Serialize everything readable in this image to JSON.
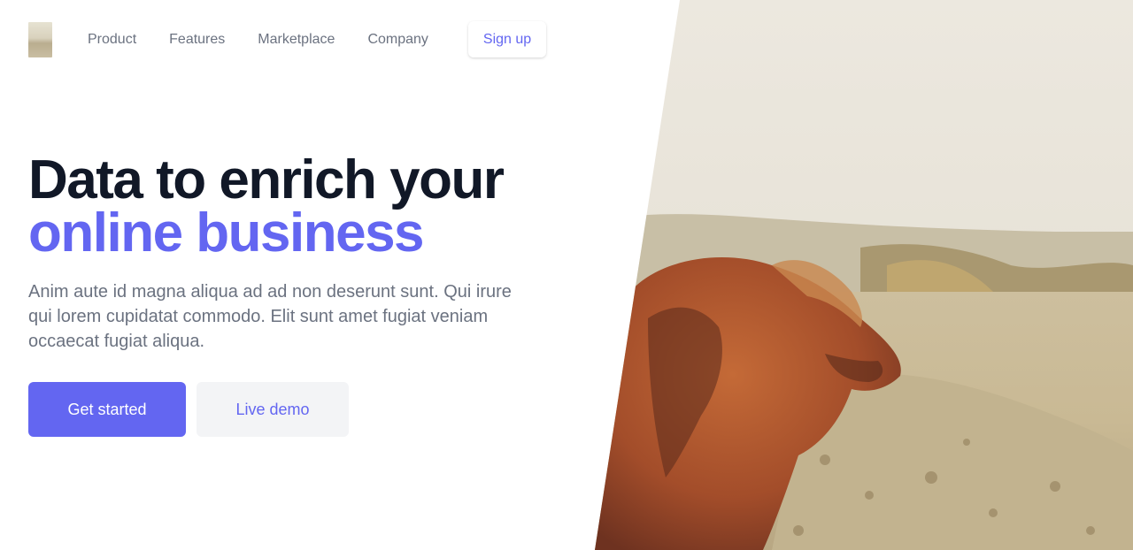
{
  "nav": {
    "items": [
      {
        "label": "Product"
      },
      {
        "label": "Features"
      },
      {
        "label": "Marketplace"
      },
      {
        "label": "Company"
      }
    ],
    "signup_label": "Sign up"
  },
  "hero": {
    "headline_line1": "Data to enrich your",
    "headline_line2": "online business",
    "description": "Anim aute id magna aliqua ad ad non deserunt sunt. Qui irure qui lorem cupidatat commodo. Elit sunt amet fugiat veniam occaecat fugiat aliqua.",
    "primary_cta": "Get started",
    "secondary_cta": "Live demo"
  },
  "colors": {
    "accent": "#6366f1",
    "heading": "#111827",
    "body_text": "#6b7280",
    "secondary_button_bg": "#f3f4f6"
  }
}
